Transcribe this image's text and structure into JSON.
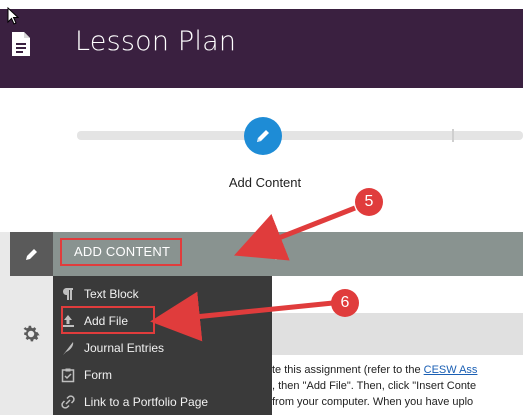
{
  "header": {
    "title": "Lesson Plan"
  },
  "progress": {
    "step_label": "Add Content"
  },
  "add_bar": {
    "label": "ADD CONTENT"
  },
  "menu": {
    "items": [
      {
        "label": "Text Block",
        "icon": "paragraph-icon"
      },
      {
        "label": "Add File",
        "icon": "upload-icon"
      },
      {
        "label": "Journal Entries",
        "icon": "feather-icon"
      },
      {
        "label": "Form",
        "icon": "checklist-icon"
      },
      {
        "label": "Link to a Portfolio Page",
        "icon": "link-icon"
      }
    ]
  },
  "content": {
    "line1_prefix": "te this assignment (refer to the ",
    "line1_link": "CESW Ass",
    "line2": ", then \"Add File\".  Then, click \"Insert Conte",
    "line3": "from your computer.  When you have uplo"
  },
  "annotations": {
    "badge1": "5",
    "badge2": "6"
  },
  "colors": {
    "header_bg": "#3a2040",
    "accent_blue": "#1e8cd6",
    "annotation_red": "#e03c3c",
    "menu_bg": "#3a3a3a"
  }
}
